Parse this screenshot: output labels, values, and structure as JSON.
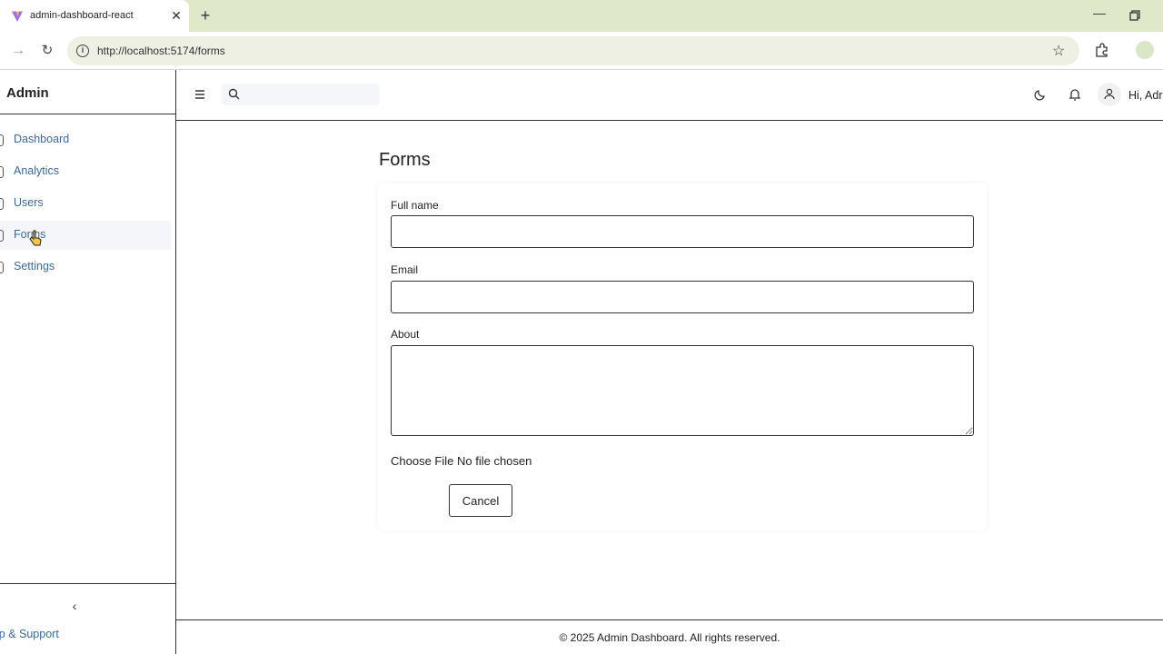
{
  "browser": {
    "tab_title": "admin-dashboard-react",
    "tab_close": "✕",
    "new_tab": "+",
    "minimize": "—",
    "url": "http://localhost:5174/forms",
    "back_glyph": "→",
    "reload_glyph": "↻",
    "star_glyph": "☆",
    "info_glyph": "i"
  },
  "sidebar": {
    "brand": "Admin",
    "items": [
      {
        "label": "Dashboard",
        "icon": "dashboard-icon"
      },
      {
        "label": "Analytics",
        "icon": "analytics-icon"
      },
      {
        "label": "Users",
        "icon": "users-icon"
      },
      {
        "label": "Forms",
        "icon": "forms-icon",
        "active": true
      },
      {
        "label": "Settings",
        "icon": "settings-icon"
      }
    ],
    "collapse_glyph": "‹",
    "help_label": "lp & Support"
  },
  "header": {
    "search_placeholder": "",
    "greeting": "Hi, Adr"
  },
  "main": {
    "title": "Forms",
    "form": {
      "full_name_label": "Full name",
      "full_name_value": "",
      "email_label": "Email",
      "email_value": "",
      "about_label": "About",
      "about_value": "",
      "file_text": "Choose File No file chosen",
      "cancel_label": "Cancel"
    }
  },
  "footer": {
    "text": "© 2025 Admin Dashboard. All rights reserved."
  },
  "colors": {
    "chrome_bg": "#dfe8c8",
    "link": "#3a6a9a",
    "border": "#333333"
  }
}
